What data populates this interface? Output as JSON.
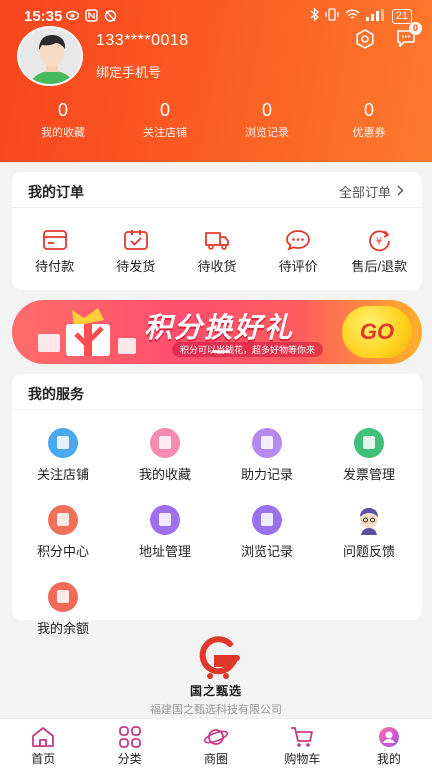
{
  "status_bar": {
    "time": "15:35",
    "battery": "21"
  },
  "profile": {
    "username": "133****0018",
    "bind_phone": "绑定手机号",
    "message_badge": "0"
  },
  "stats": [
    {
      "value": "0",
      "label": "我的收藏"
    },
    {
      "value": "0",
      "label": "关注店铺"
    },
    {
      "value": "0",
      "label": "浏览记录"
    },
    {
      "value": "0",
      "label": "优惠券"
    }
  ],
  "orders": {
    "title": "我的订单",
    "all_label": "全部订单",
    "items": [
      {
        "label": "待付款",
        "icon": "wallet-icon"
      },
      {
        "label": "待发货",
        "icon": "package-icon"
      },
      {
        "label": "待收货",
        "icon": "truck-icon"
      },
      {
        "label": "待评价",
        "icon": "comment-icon"
      },
      {
        "label": "售后/退款",
        "icon": "refund-icon"
      }
    ]
  },
  "banner": {
    "title": "积分换好礼",
    "subtitle": "积分可以当钱花，超多好物等你来",
    "go": "GO"
  },
  "services": {
    "title": "我的服务",
    "items": [
      {
        "label": "关注店铺",
        "color": "#4aa8f0",
        "icon": "store-icon"
      },
      {
        "label": "我的收藏",
        "color": "#f58bb0",
        "icon": "favorite-icon"
      },
      {
        "label": "助力记录",
        "color": "#b58af0",
        "icon": "location-icon"
      },
      {
        "label": "发票管理",
        "color": "#3fc07a",
        "icon": "invoice-icon"
      },
      {
        "label": "积分中心",
        "color": "#f2705a",
        "icon": "points-icon"
      },
      {
        "label": "地址管理",
        "color": "#a26ef0",
        "icon": "address-icon"
      },
      {
        "label": "浏览记录",
        "color": "#9a72f0",
        "icon": "history-icon"
      },
      {
        "label": "问题反馈",
        "color": "#f5f5f5",
        "icon": "feedback-icon"
      },
      {
        "label": "我的余额",
        "color": "#f06a5a",
        "icon": "balance-icon"
      }
    ]
  },
  "brand": {
    "name": "国之甄选",
    "company": "福建国之甄选科技有限公司"
  },
  "tabbar": [
    {
      "label": "首页",
      "icon": "home-icon"
    },
    {
      "label": "分类",
      "icon": "category-icon"
    },
    {
      "label": "商圈",
      "icon": "planet-icon"
    },
    {
      "label": "购物车",
      "icon": "cart-icon"
    },
    {
      "label": "我的",
      "icon": "profile-icon"
    }
  ],
  "colors": {
    "accent": "#f7441f",
    "accent_pink": "#e0337a"
  }
}
